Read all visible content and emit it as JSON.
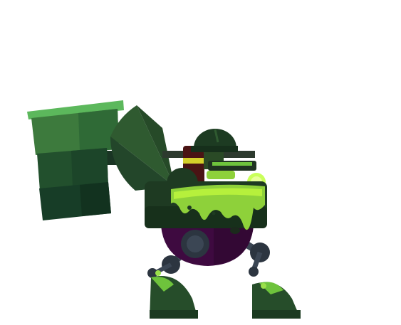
{
  "scene": {
    "background": "#ffffff",
    "subject": "green-slime-mech-with-hammer"
  },
  "palette": {
    "hammer_top": "#5cb85c",
    "hammer_light": "#3d7a3d",
    "hammer_mid": "#2a5e33",
    "hammer_dark": "#173d27",
    "armor_dark": "#1e3a22",
    "armor_mid": "#2b4f2c",
    "slime": "#8ed13a",
    "slime_bright": "#b6f03c",
    "slime_glow": "#c9ff5a",
    "body_purple": "#3e0a40",
    "joint_gray": "#2c3540",
    "joint_light": "#3b4654",
    "pilot_red": "#4a1414",
    "visor_yellow": "#d4d02a",
    "gun_metal": "#2d3a2e"
  },
  "icons": {
    "hammer": "mech-hammer-icon",
    "shield": "mech-shield-icon",
    "helmet": "pilot-helmet-icon",
    "gun": "slime-gun-icon"
  }
}
